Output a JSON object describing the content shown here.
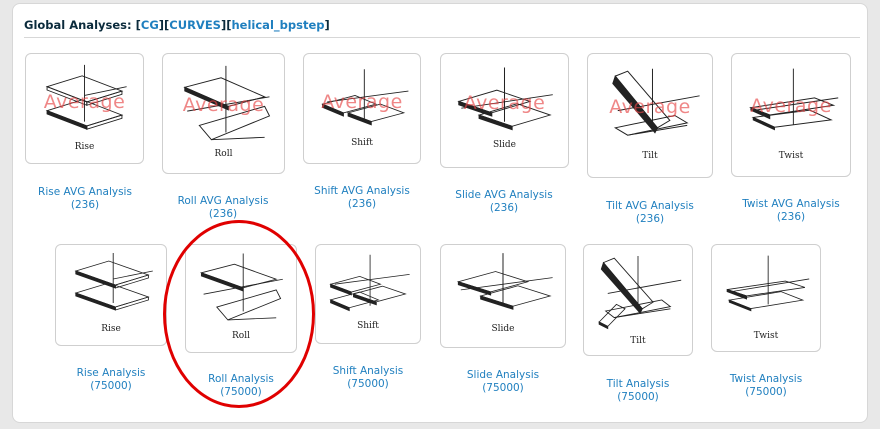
{
  "header": {
    "title": "Global Analyses:",
    "crumbs": [
      "CG",
      "CURVES",
      "helical_bpstep"
    ],
    "open": "[",
    "close": "]"
  },
  "overlay_text": "Average",
  "avg_row": [
    {
      "label": "Rise AVG Analysis",
      "count": "(236)",
      "caption": "Rise",
      "icon": "rise-diagram"
    },
    {
      "label": "Roll AVG Analysis",
      "count": "(236)",
      "caption": "Roll",
      "icon": "roll-diagram"
    },
    {
      "label": "Shift AVG Analysis",
      "count": "(236)",
      "caption": "Shift",
      "icon": "shift-diagram"
    },
    {
      "label": "Slide AVG Analysis",
      "count": "(236)",
      "caption": "Slide",
      "icon": "slide-diagram"
    },
    {
      "label": "Tilt AVG Analysis",
      "count": "(236)",
      "caption": "Tilt",
      "icon": "tilt-diagram"
    },
    {
      "label": "Twist AVG Analysis",
      "count": "(236)",
      "caption": "Twist",
      "icon": "twist-diagram"
    }
  ],
  "full_row": [
    {
      "label": "Rise Analysis",
      "count": "(75000)",
      "caption": "Rise",
      "icon": "rise-diagram"
    },
    {
      "label": "Roll Analysis",
      "count": "(75000)",
      "caption": "Roll",
      "icon": "roll-diagram"
    },
    {
      "label": "Shift Analysis",
      "count": "(75000)",
      "caption": "Shift",
      "icon": "shift-diagram"
    },
    {
      "label": "Slide Analysis",
      "count": "(75000)",
      "caption": "Slide",
      "icon": "slide-diagram"
    },
    {
      "label": "Tilt Analysis",
      "count": "(75000)",
      "caption": "Tilt",
      "icon": "tilt-diagram"
    },
    {
      "label": "Twist Analysis",
      "count": "(75000)",
      "caption": "Twist",
      "icon": "twist-diagram"
    }
  ],
  "colors": {
    "link": "#1f7fbf",
    "highlight": "#e00000",
    "overlay": "#e64646"
  }
}
